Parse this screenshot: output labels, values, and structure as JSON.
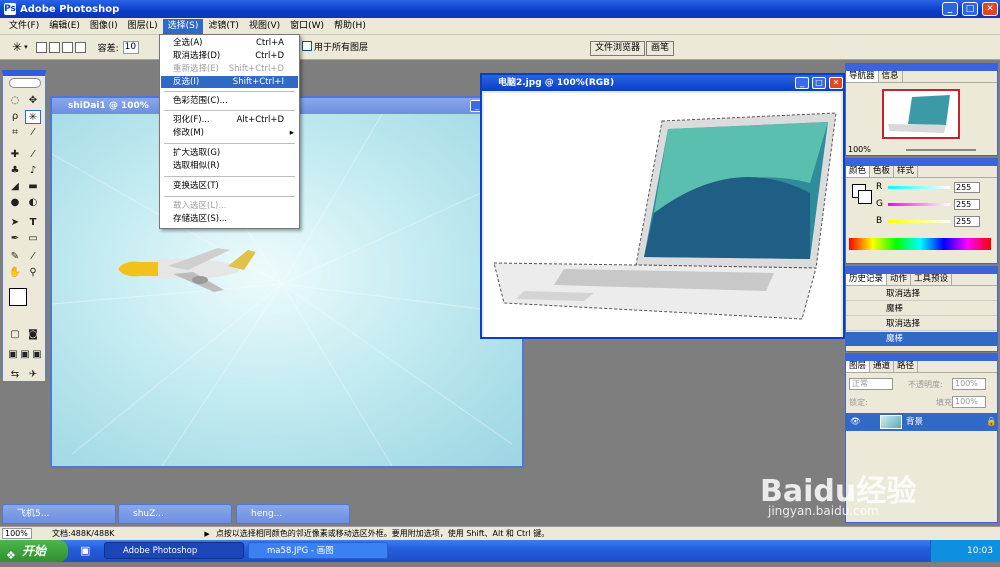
{
  "app": {
    "title": "Adobe Photoshop"
  },
  "menubar": {
    "items": [
      "文件(F)",
      "编辑(E)",
      "图像(I)",
      "图层(L)",
      "选择(S)",
      "滤镜(T)",
      "视图(V)",
      "窗口(W)",
      "帮助(H)"
    ]
  },
  "options": {
    "tolerance_label": "容差:",
    "tolerance_value": "10",
    "all_layers_label": "用于所有图层",
    "tabs": [
      "文件浏览器",
      "画笔"
    ]
  },
  "select_menu": {
    "items": [
      {
        "label": "全选(A)",
        "shortcut": "Ctrl+A"
      },
      {
        "label": "取消选择(D)",
        "shortcut": "Ctrl+D"
      },
      {
        "label": "重新选择(E)",
        "shortcut": "Shift+Ctrl+D"
      },
      {
        "label": "反选(I)",
        "shortcut": "Shift+Ctrl+I"
      },
      {
        "label": "色彩范围(C)..."
      },
      {
        "label": "羽化(F)...",
        "shortcut": "Alt+Ctrl+D"
      },
      {
        "label": "修改(M)"
      },
      {
        "label": "扩大选取(G)"
      },
      {
        "label": "选取相似(R)"
      },
      {
        "label": "变换选区(T)"
      },
      {
        "label": "载入选区(L)..."
      },
      {
        "label": "存储选区(S)..."
      }
    ]
  },
  "documents": {
    "background_doc_title": "shiDai1 @ 100%",
    "active_doc_title": "电脑2.jpg @ 100%(RGB)"
  },
  "minimized": [
    "飞机5...",
    "shuZ...",
    "heng..."
  ],
  "panels": {
    "navigator": {
      "tabs": [
        "导航器",
        "信息"
      ],
      "zoom": "100%"
    },
    "color": {
      "tabs": [
        "颜色",
        "色板",
        "样式"
      ],
      "channels": [
        {
          "name": "R",
          "value": "255"
        },
        {
          "name": "G",
          "value": "255"
        },
        {
          "name": "B",
          "value": "255"
        }
      ]
    },
    "history": {
      "tabs": [
        "历史记录",
        "动作",
        "工具预设"
      ],
      "items": [
        "取消选择",
        "魔棒",
        "取消选择",
        "魔棒"
      ]
    },
    "layers": {
      "tabs": [
        "图层",
        "通道",
        "路径"
      ],
      "blend_mode": "正常",
      "opacity_label": "不透明度:",
      "opacity_value": "100%",
      "lock_label": "锁定:",
      "fill_label": "填充:",
      "fill_value": "100%",
      "layer_name": "背景"
    }
  },
  "status": {
    "zoom": "100%",
    "doc_info": "文档:488K/488K",
    "hint": "点按以选择相同颜色的邻近像素或移动选区外框。要用附加选项，使用 Shift、Alt 和 Ctrl 键。"
  },
  "taskbar": {
    "start": "开始",
    "buttons": [
      "Adobe Photoshop",
      "ma58.JPG - 画图"
    ],
    "clock": "10:03"
  },
  "watermark": {
    "brand": "Baidu经验",
    "url": "jingyan.baidu.com"
  },
  "colors": {
    "xp_blue": "#0a3ec9",
    "menu_highlight": "#316ac5",
    "canvas_sky": "#bfe8ee"
  }
}
